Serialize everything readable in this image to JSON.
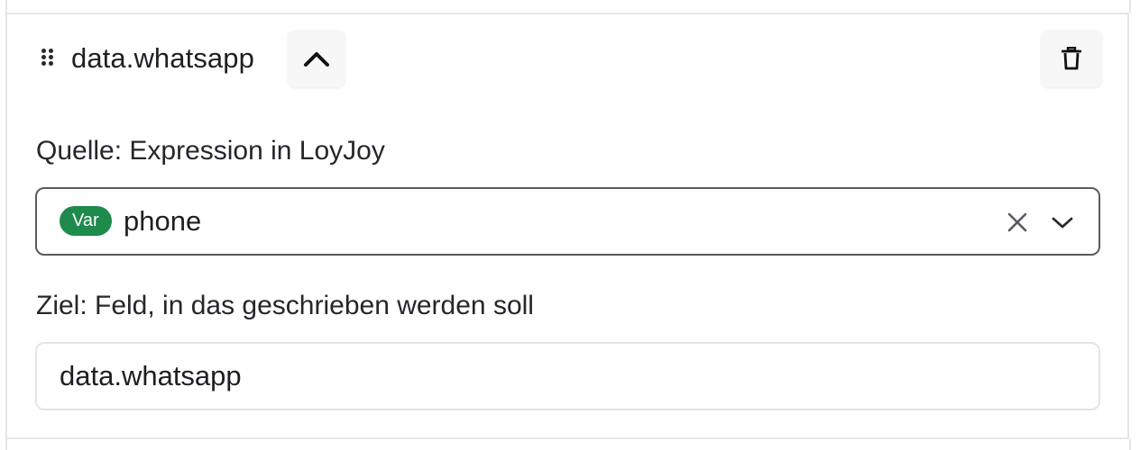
{
  "header": {
    "title": "data.whatsapp",
    "collapse_icon": "chevron-up-icon",
    "delete_icon": "trash-icon",
    "drag_icon": "drag-handle-icon"
  },
  "source": {
    "label": "Quelle: Expression in LoyJoy",
    "badge": "Var",
    "value": "phone",
    "badge_color": "#1e8a4c",
    "clear_icon": "close-icon",
    "dropdown_icon": "chevron-down-icon"
  },
  "target": {
    "label": "Ziel: Feld, in das geschrieben werden soll",
    "value": "data.whatsapp"
  }
}
